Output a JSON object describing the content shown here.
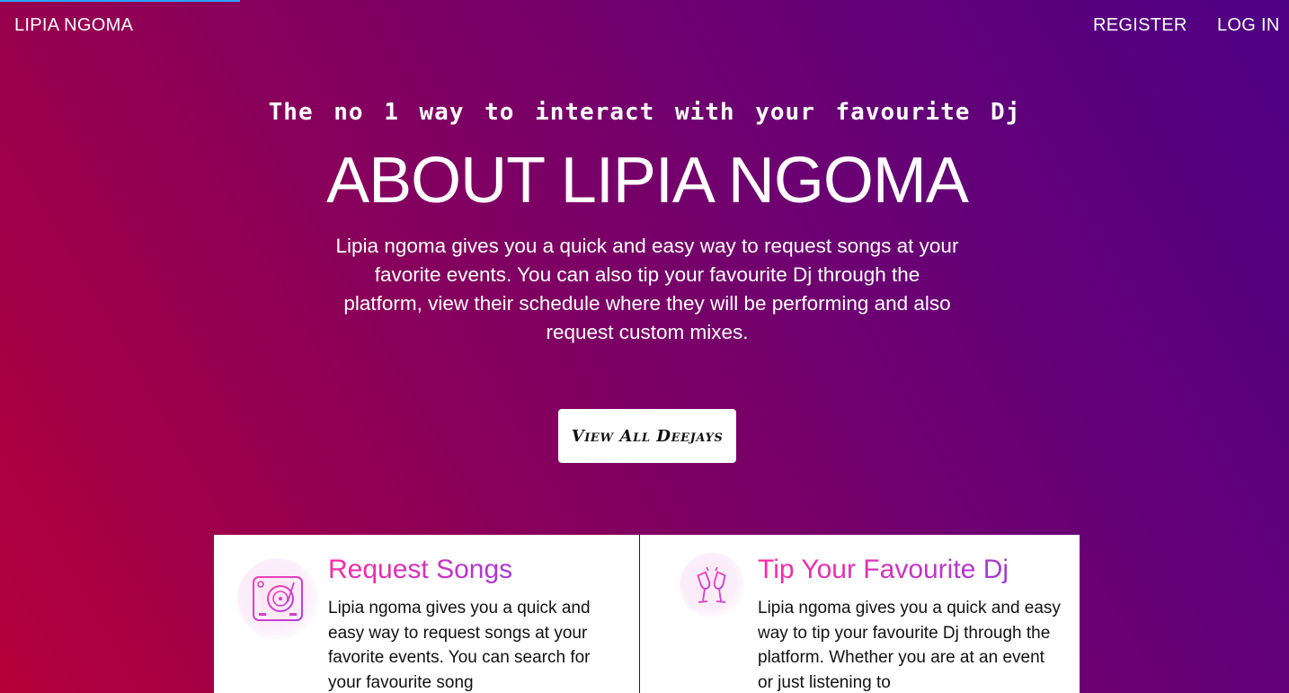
{
  "nav": {
    "brand": "LIPIA NGOMA",
    "register": "REGISTER",
    "login": "LOG IN"
  },
  "hero": {
    "tagline": "The no 1 way to interact with your favourite Dj",
    "title": "ABOUT LIPIA NGOMA",
    "description": "Lipia ngoma gives you a quick and easy way to request songs at your favorite events. You can also tip your favourite Dj through the platform, view their schedule where they will be performing and also request custom mixes.",
    "cta": "View All Deejays"
  },
  "features": [
    {
      "icon": "turntable-icon",
      "title": "Request Songs",
      "text": "Lipia ngoma gives you a quick and easy way to request songs at your favorite events. You can search for your favourite song"
    },
    {
      "icon": "cheers-icon",
      "title": "Tip Your Favourite Dj",
      "text": "Lipia ngoma gives you a quick and easy way to tip your favourite Dj through the platform. Whether you are at an event or just listening to"
    }
  ],
  "colors": {
    "gradient_start": "#b5003a",
    "gradient_end": "#4e0085",
    "card_title_start": "#ff2aa0",
    "card_title_end": "#a43ad6",
    "progress": "#29a3ff"
  }
}
